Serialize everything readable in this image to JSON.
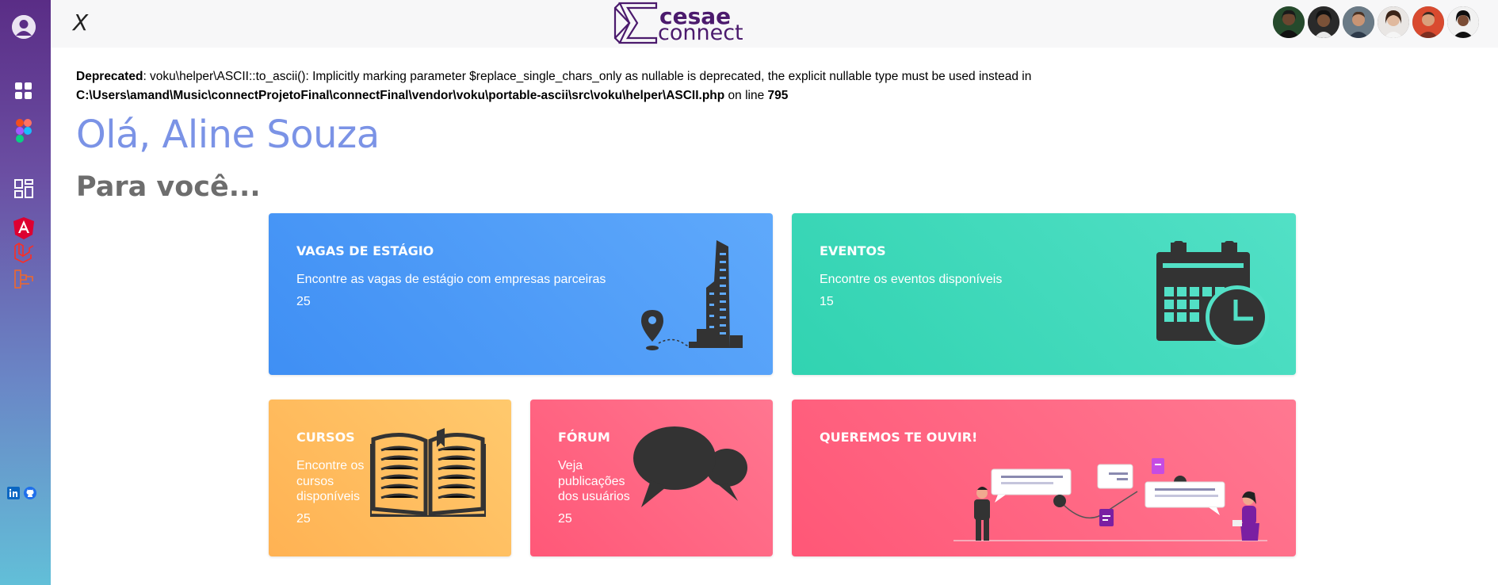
{
  "sidebar": {
    "items": [
      {
        "name": "dashboard-icon"
      },
      {
        "name": "figma-icon"
      },
      {
        "name": "layout-icon"
      },
      {
        "name": "angular-icon"
      },
      {
        "name": "laravel-icon"
      },
      {
        "name": "framework-icon"
      }
    ],
    "social": [
      "linkedin-icon",
      "github-icon"
    ]
  },
  "topbar": {
    "close_label": "X",
    "logo_line1": "cesae",
    "logo_line2": "connect",
    "team_count": 6
  },
  "warning": {
    "label": "Deprecated",
    "message": ": voku\\helper\\ASCII::to_ascii(): Implicitly marking parameter $replace_single_chars_only as nullable is deprecated, the explicit nullable type must be used instead in",
    "path": "C:\\Users\\amand\\Music\\connectProjetoFinal\\connectFinal\\vendor\\voku\\portable-ascii\\src\\voku\\helper\\ASCII.php",
    "on_line": " on line ",
    "line": "795"
  },
  "greeting": "Olá, Aline Souza",
  "section_title": "Para você...",
  "cards": {
    "vagas": {
      "title": "VAGAS DE ESTÁGIO",
      "desc": "Encontre as vagas de estágio com empresas parceiras",
      "count": "25"
    },
    "eventos": {
      "title": "EVENTOS",
      "desc": "Encontre os eventos disponíveis",
      "count": "15"
    },
    "cursos": {
      "title": "CURSOS",
      "desc": "Encontre os cursos disponíveis",
      "count": "25"
    },
    "forum": {
      "title": "FÓRUM",
      "desc": "Veja publicações dos usuários",
      "count": "25"
    },
    "ouvir": {
      "title": "QUEREMOS TE OUVIR!"
    }
  },
  "colors": {
    "sidebar_top": "#5a2d86",
    "sidebar_bottom": "#62bfd8",
    "greeting": "#7b93e6",
    "vagas": "#3f8ff4",
    "eventos": "#31d3b1",
    "cursos": "#ffb253",
    "forum": "#ff5878",
    "ouvir": "#ff5777"
  }
}
